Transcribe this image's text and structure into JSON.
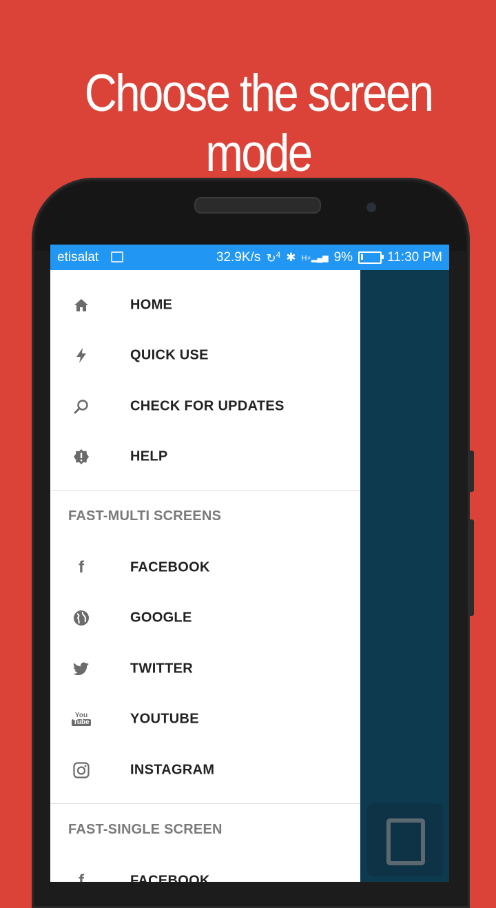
{
  "headline": "Choose the screen mode",
  "status_bar": {
    "carrier": "etisalat",
    "net_speed": "32.9K/s",
    "signal_sup": "4",
    "network_type": "H+",
    "battery": "9%",
    "time": "11:30 PM"
  },
  "menu": {
    "main": [
      {
        "label": "HOME",
        "icon": "home-icon"
      },
      {
        "label": "QUICK USE",
        "icon": "bolt-icon"
      },
      {
        "label": "CHECK FOR UPDATES",
        "icon": "search-icon"
      },
      {
        "label": "HELP",
        "icon": "help-badge-icon"
      }
    ],
    "multi_title": "FAST-MULTI SCREENS",
    "multi": [
      {
        "label": "FACEBOOK",
        "icon": "facebook-icon"
      },
      {
        "label": "GOOGLE",
        "icon": "globe-icon"
      },
      {
        "label": "TWITTER",
        "icon": "twitter-icon"
      },
      {
        "label": "YOUTUBE",
        "icon": "youtube-icon"
      },
      {
        "label": "INSTAGRAM",
        "icon": "instagram-icon"
      }
    ],
    "single_title": "FAST-SINGLE SCREEN",
    "single": [
      {
        "label": "FACEBOOK",
        "icon": "facebook-icon"
      }
    ]
  },
  "colors": {
    "background": "#dc4338",
    "status_bar": "#2196f3",
    "content_bg": "#0d3a4e"
  }
}
